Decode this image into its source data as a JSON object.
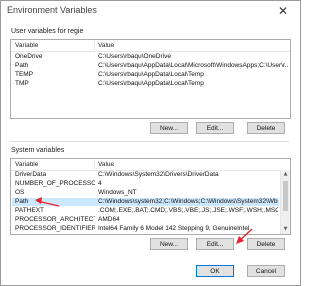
{
  "window": {
    "title": "Environment Variables",
    "close_glyph": "✕"
  },
  "user_section": {
    "label": "User variables for regie",
    "columns": [
      "Variable",
      "Value"
    ],
    "rows": [
      {
        "variable": "OneDrive",
        "value": "C:\\Users\\rbaqu\\OneDrive"
      },
      {
        "variable": "Path",
        "value": "C:\\Users\\rbaqu\\AppData\\Local\\Microsoft\\WindowsApps;C:\\User\\r..."
      },
      {
        "variable": "TEMP",
        "value": "C:\\Users\\rbaqu\\AppData\\Local\\Temp"
      },
      {
        "variable": "TMP",
        "value": "C:\\Users\\rbaqu\\AppData\\Local\\Temp"
      }
    ],
    "buttons": {
      "new": "New...",
      "edit": "Edit...",
      "delete": "Delete"
    }
  },
  "system_section": {
    "label": "System variables",
    "columns": [
      "Variable",
      "Value"
    ],
    "rows": [
      {
        "variable": "DriverData",
        "value": "C:\\Windows\\System32\\Drivers\\DriverData"
      },
      {
        "variable": "NUMBER_OF_PROCESSORS",
        "value": "4"
      },
      {
        "variable": "OS",
        "value": "Windows_NT"
      },
      {
        "variable": "Path",
        "value": "C:\\Windows\\system32;C:\\Windows;C:\\Windows\\System32\\Wbem;..."
      },
      {
        "variable": "PATHEXT",
        "value": ".COM;.EXE;.BAT;.CMD;.VBS;.VBE;.JS;.JSE;.WSF;.WSH;.MSC"
      },
      {
        "variable": "PROCESSOR_ARCHITECTURE",
        "value": "AMD64"
      },
      {
        "variable": "PROCESSOR_IDENTIFIER",
        "value": "Intel64 Family 6 Model 142 Stepping 9, GenuineIntel"
      }
    ],
    "selected_row": "Path",
    "buttons": {
      "new": "New...",
      "edit": "Edit...",
      "delete": "Delete"
    }
  },
  "footer": {
    "ok": "OK",
    "cancel": "Cancel"
  },
  "colors": {
    "selection": "#cce8ff",
    "arrow": "#e8242a",
    "default_button_border": "#0078d7"
  },
  "icons": {
    "scroll_up": "▲",
    "scroll_down": "▼"
  }
}
